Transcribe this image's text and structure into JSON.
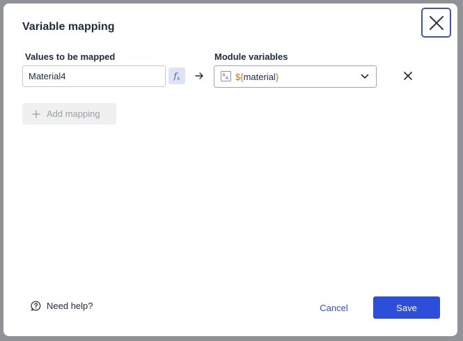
{
  "dialog": {
    "title": "Variable mapping",
    "close_icon": "close-icon"
  },
  "mapping": {
    "values_label": "Values to be mapped",
    "module_label": "Module variables",
    "rows": [
      {
        "value": "Material4",
        "formula_icon": "fx-icon",
        "arrow_icon": "arrow-right-icon",
        "module_variable": {
          "type_icon": "text-type-icon",
          "prefix": "${",
          "name": "material",
          "suffix": "}"
        },
        "remove_icon": "remove-icon"
      }
    ],
    "add_label": "Add mapping"
  },
  "footer": {
    "help_label": "Need help?",
    "help_icon": "help-icon",
    "cancel_label": "Cancel",
    "save_label": "Save"
  },
  "colors": {
    "primary": "#2c4ed8",
    "text": "#1b2a41",
    "accent_brace": "#d8720f",
    "backdrop": "#8f9297"
  }
}
